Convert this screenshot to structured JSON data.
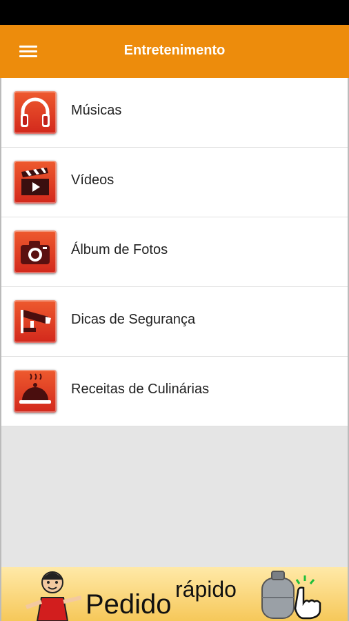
{
  "app_bar": {
    "title": "Entretenimento",
    "color": "#ed8c0c",
    "menu_icon": "hamburger-menu-icon"
  },
  "menu": {
    "items": [
      {
        "label": "Músicas",
        "icon": "headphones-icon"
      },
      {
        "label": "Vídeos",
        "icon": "clapperboard-icon"
      },
      {
        "label": "Álbum de Fotos",
        "icon": "camera-icon"
      },
      {
        "label": "Dicas de Segurança",
        "icon": "security-camera-icon"
      },
      {
        "label": "Receitas de Culinárias",
        "icon": "cloche-icon"
      }
    ]
  },
  "banner": {
    "main_text": "Pedido",
    "sub_text": "rápido"
  }
}
